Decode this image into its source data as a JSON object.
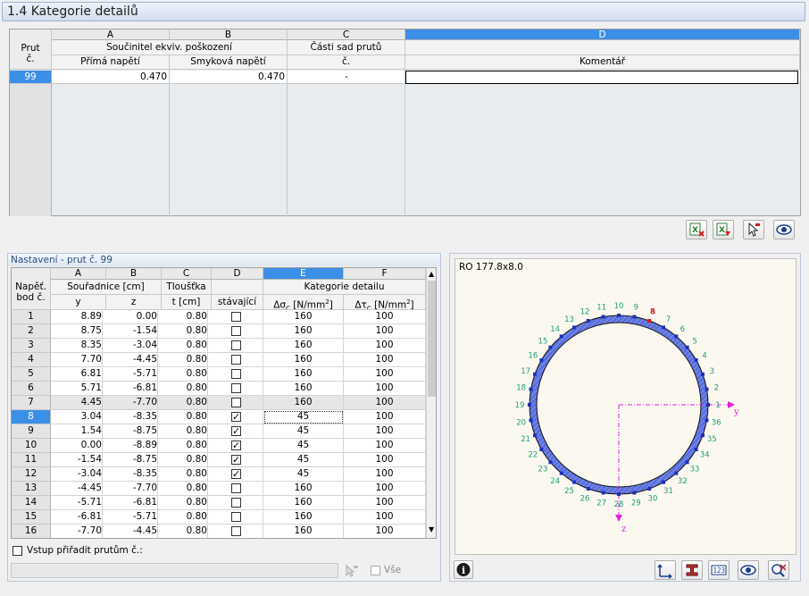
{
  "title": "1.4 Kategorie detailů",
  "top_table": {
    "row_header_label_1": "Prut",
    "row_header_label_2": "č.",
    "columns": [
      {
        "letter": "A",
        "group": "Součinitel ekviv. poškození",
        "sub": "Přímá napětí"
      },
      {
        "letter": "B",
        "group": "",
        "sub": "Smyková napětí"
      },
      {
        "letter": "C",
        "group": "Části sad prutů",
        "sub": "č."
      },
      {
        "letter": "D",
        "group": "",
        "sub": "Komentář"
      }
    ],
    "rows": [
      {
        "member": "99",
        "a": "0.470",
        "b": "0.470",
        "c": "-",
        "d": ""
      }
    ]
  },
  "top_icons": [
    "excel-export-icon",
    "excel-import-icon",
    "pick-member-icon",
    "view-icon"
  ],
  "settings": {
    "header": "Nastavení - prut č. 99",
    "rowhdr_1": "Napěť.",
    "rowhdr_2": "bod č.",
    "columns": {
      "A": "A",
      "B": "B",
      "C": "C",
      "D": "D",
      "E": "E",
      "F": "F",
      "coords_group": "Souřadnice [cm]",
      "y": "y",
      "z": "z",
      "thickness_1": "Tloušťka",
      "thickness_2": "t [cm]",
      "existing": "stávající",
      "detail_group": "Kategorie detailu",
      "dsigma": "Δσ",
      "dsigma_sub": "C",
      "dsigma_unit": " [N/mm",
      "dtau": "Δτ",
      "dtau_sub": "C",
      "dtau_unit": " [N/mm",
      "sq": "2",
      "close": "]"
    },
    "rows": [
      {
        "n": "1",
        "y": "8.89",
        "z": "0.00",
        "t": "0.80",
        "chk": false,
        "ds": "160",
        "dt": "100"
      },
      {
        "n": "2",
        "y": "8.75",
        "z": "-1.54",
        "t": "0.80",
        "chk": false,
        "ds": "160",
        "dt": "100"
      },
      {
        "n": "3",
        "y": "8.35",
        "z": "-3.04",
        "t": "0.80",
        "chk": false,
        "ds": "160",
        "dt": "100"
      },
      {
        "n": "4",
        "y": "7.70",
        "z": "-4.45",
        "t": "0.80",
        "chk": false,
        "ds": "160",
        "dt": "100"
      },
      {
        "n": "5",
        "y": "6.81",
        "z": "-5.71",
        "t": "0.80",
        "chk": false,
        "ds": "160",
        "dt": "100"
      },
      {
        "n": "6",
        "y": "5.71",
        "z": "-6.81",
        "t": "0.80",
        "chk": false,
        "ds": "160",
        "dt": "100"
      },
      {
        "n": "7",
        "y": "4.45",
        "z": "-7.70",
        "t": "0.80",
        "chk": false,
        "ds": "160",
        "dt": "100"
      },
      {
        "n": "8",
        "y": "3.04",
        "z": "-8.35",
        "t": "0.80",
        "chk": true,
        "ds": "45",
        "dt": "100"
      },
      {
        "n": "9",
        "y": "1.54",
        "z": "-8.75",
        "t": "0.80",
        "chk": true,
        "ds": "45",
        "dt": "100"
      },
      {
        "n": "10",
        "y": "0.00",
        "z": "-8.89",
        "t": "0.80",
        "chk": true,
        "ds": "45",
        "dt": "100"
      },
      {
        "n": "11",
        "y": "-1.54",
        "z": "-8.75",
        "t": "0.80",
        "chk": true,
        "ds": "45",
        "dt": "100"
      },
      {
        "n": "12",
        "y": "-3.04",
        "z": "-8.35",
        "t": "0.80",
        "chk": true,
        "ds": "45",
        "dt": "100"
      },
      {
        "n": "13",
        "y": "-4.45",
        "z": "-7.70",
        "t": "0.80",
        "chk": false,
        "ds": "160",
        "dt": "100"
      },
      {
        "n": "14",
        "y": "-5.71",
        "z": "-6.81",
        "t": "0.80",
        "chk": false,
        "ds": "160",
        "dt": "100"
      },
      {
        "n": "15",
        "y": "-6.81",
        "z": "-5.71",
        "t": "0.80",
        "chk": false,
        "ds": "160",
        "dt": "100"
      },
      {
        "n": "16",
        "y": "-7.70",
        "z": "-4.45",
        "t": "0.80",
        "chk": false,
        "ds": "160",
        "dt": "100"
      }
    ],
    "selected_row": "8",
    "assign_label": "Vstup přiřadit prutům č.:",
    "assign_value": "",
    "all_label": "Vše"
  },
  "preview": {
    "section_name": "RO 177.8x8.0",
    "axis_y": "y",
    "axis_z": "z",
    "point_labels": [
      "1",
      "2",
      "3",
      "4",
      "5",
      "6",
      "7",
      "8",
      "9",
      "10",
      "11",
      "12",
      "13",
      "14",
      "15",
      "16",
      "17",
      "18",
      "19",
      "20",
      "21",
      "22",
      "23",
      "24",
      "25",
      "26",
      "27",
      "28",
      "29",
      "30",
      "31",
      "32",
      "33",
      "34",
      "35",
      "36"
    ],
    "selected_point": "8",
    "colors": {
      "ring": "#5a6fdc",
      "point": "#1a2fbf",
      "label": "#1f9e7f",
      "axis": "#e020e0",
      "selected": "#e01010"
    }
  },
  "preview_icons": [
    "info-icon",
    "axes-icon",
    "section-icon",
    "numbering-icon",
    "view-icon",
    "zoom-reset-icon"
  ]
}
